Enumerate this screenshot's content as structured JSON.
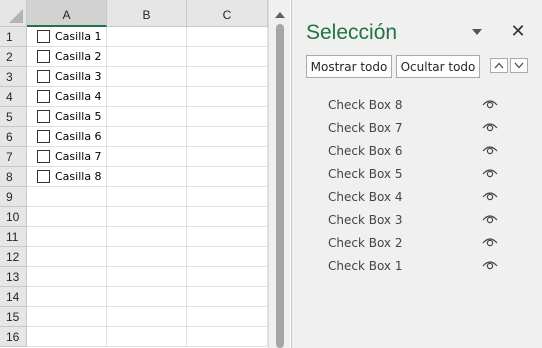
{
  "sheet": {
    "columns": [
      "A",
      "B",
      "C"
    ],
    "rows": [
      "1",
      "2",
      "3",
      "4",
      "5",
      "6",
      "7",
      "8",
      "9",
      "10",
      "11",
      "12",
      "13",
      "14",
      "15",
      "16"
    ],
    "checkboxes": [
      {
        "label": "Casilla 1",
        "checked": false
      },
      {
        "label": "Casilla 2",
        "checked": false
      },
      {
        "label": "Casilla 3",
        "checked": false
      },
      {
        "label": "Casilla 4",
        "checked": false
      },
      {
        "label": "Casilla 5",
        "checked": false
      },
      {
        "label": "Casilla 6",
        "checked": false
      },
      {
        "label": "Casilla 7",
        "checked": false
      },
      {
        "label": "Casilla 8",
        "checked": false
      }
    ]
  },
  "pane": {
    "title": "Selección",
    "close_icon": "✕",
    "show_all_label": "Mostrar todo",
    "hide_all_label": "Ocultar todo",
    "move_up_icon": "chevron-up-icon",
    "move_down_icon": "chevron-down-icon",
    "items": [
      {
        "name": "Check Box 8",
        "visible": true
      },
      {
        "name": "Check Box 7",
        "visible": true
      },
      {
        "name": "Check Box 6",
        "visible": true
      },
      {
        "name": "Check Box 5",
        "visible": true
      },
      {
        "name": "Check Box 4",
        "visible": true
      },
      {
        "name": "Check Box 3",
        "visible": true
      },
      {
        "name": "Check Box 2",
        "visible": true
      },
      {
        "name": "Check Box 1",
        "visible": true
      }
    ]
  },
  "colors": {
    "accent": "#217346",
    "header_bg": "#e6e6e6",
    "pane_bg": "#f0f0f0"
  }
}
